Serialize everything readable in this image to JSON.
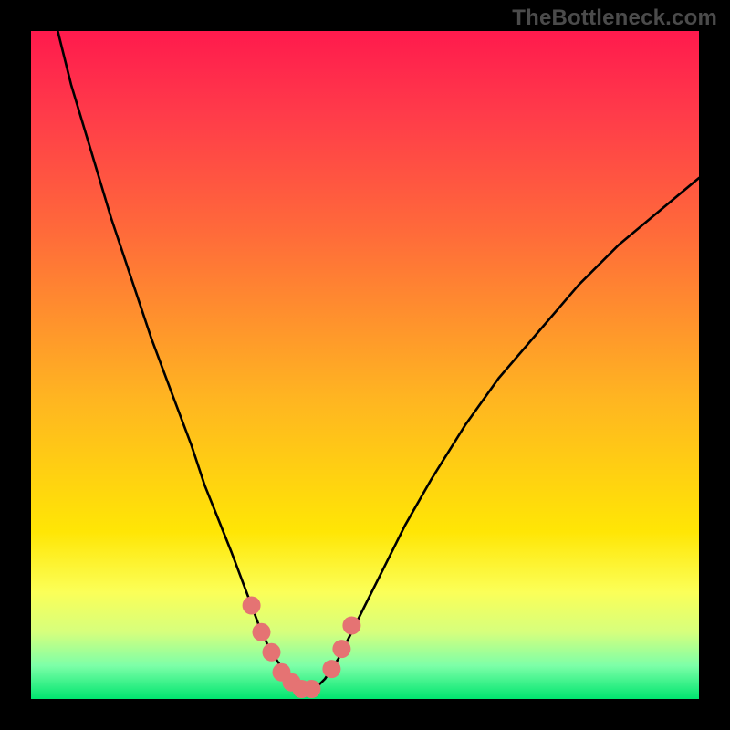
{
  "watermark": "TheBottleneck.com",
  "colors": {
    "page_bg": "#000000",
    "gradient_top": "#ff1a4d",
    "gradient_bottom": "#00e56f",
    "curve": "#000000",
    "markers": "#e57373"
  },
  "chart_data": {
    "type": "line",
    "title": "",
    "xlabel": "",
    "ylabel": "",
    "xlim": [
      0,
      100
    ],
    "ylim": [
      0,
      100
    ],
    "grid": false,
    "series": [
      {
        "name": "bottleneck-curve",
        "x": [
          4,
          6,
          9,
          12,
          15,
          18,
          21,
          24,
          26,
          28,
          30,
          31.5,
          33,
          34.5,
          36,
          38,
          39.5,
          41,
          42.5,
          44,
          46,
          48,
          50,
          53,
          56,
          60,
          65,
          70,
          76,
          82,
          88,
          94,
          100
        ],
        "y": [
          100,
          92,
          82,
          72,
          63,
          54,
          46,
          38,
          32,
          27,
          22,
          18,
          14,
          10,
          7,
          4,
          2,
          1.2,
          1.5,
          3,
          6,
          10,
          14,
          20,
          26,
          33,
          41,
          48,
          55,
          62,
          68,
          73,
          78
        ]
      }
    ],
    "markers": {
      "name": "bottom-dots",
      "x": [
        33,
        34.5,
        36,
        37.5,
        39,
        40.5,
        42,
        45,
        46.5,
        48
      ],
      "y": [
        14,
        10,
        7,
        4,
        2.5,
        1.5,
        1.5,
        4.5,
        7.5,
        11
      ]
    }
  }
}
